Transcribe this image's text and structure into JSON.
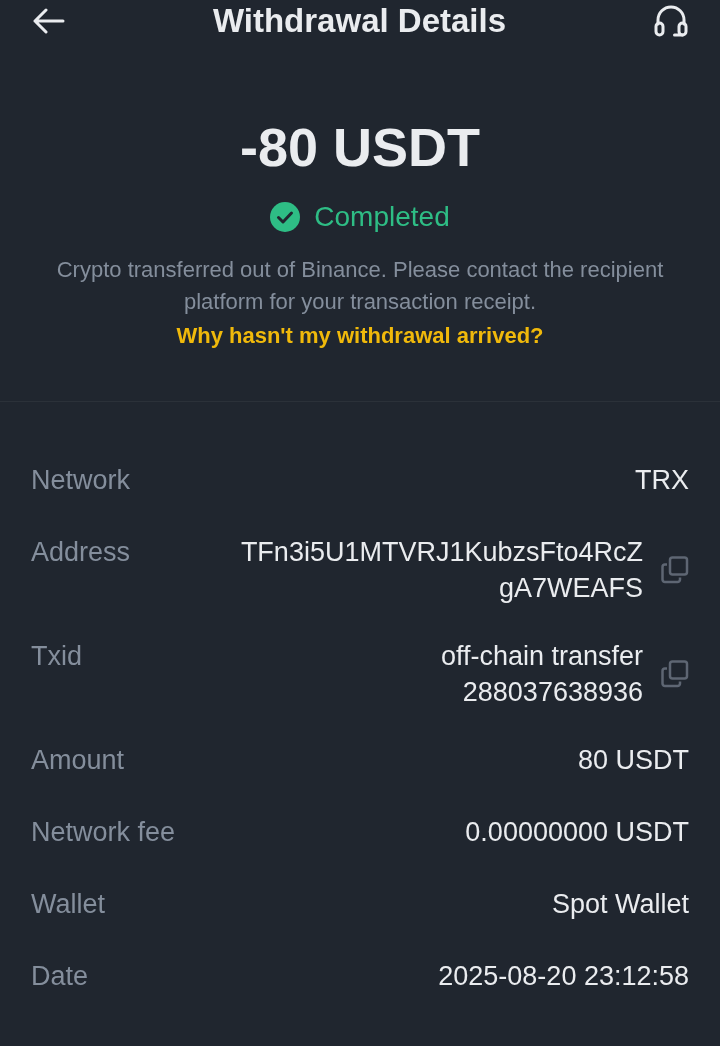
{
  "header": {
    "title": "Withdrawal Details"
  },
  "summary": {
    "amount": "-80 USDT",
    "status": {
      "label": "Completed",
      "kind": "completed"
    },
    "note": "Crypto transferred out of Binance. Please contact the recipient platform for your transaction receipt.",
    "help_link": "Why hasn't my withdrawal arrived?"
  },
  "details": [
    {
      "label": "Network",
      "lines": [
        "TRX"
      ],
      "copyable": false
    },
    {
      "label": "Address",
      "lines": [
        "TFn3i5U1MTVRJ1KubzsFto4RcZ",
        "gA7WEAFS"
      ],
      "copyable": true
    },
    {
      "label": "Txid",
      "lines": [
        "off-chain transfer",
        "288037638936"
      ],
      "copyable": true
    },
    {
      "label": "Amount",
      "lines": [
        "80 USDT"
      ],
      "copyable": false
    },
    {
      "label": "Network fee",
      "lines": [
        "0.00000000 USDT"
      ],
      "copyable": false
    },
    {
      "label": "Wallet",
      "lines": [
        "Spot Wallet"
      ],
      "copyable": false
    },
    {
      "label": "Date",
      "lines": [
        "2025-08-20 23:12:58"
      ],
      "copyable": false
    }
  ]
}
